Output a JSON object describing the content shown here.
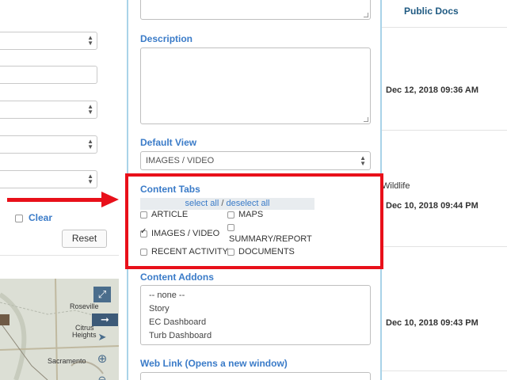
{
  "left_panel": {
    "clear_label": "Clear",
    "reset_label": "Reset"
  },
  "map": {
    "labels": [
      "Roseville",
      "Citrus",
      "Heights",
      "Sacramento"
    ],
    "expand_icon": "expand-icon",
    "arrow_icon": "arrow-right-icon",
    "pointer_icon": "cursor-icon",
    "zoom_icon": "zoom-in-icon"
  },
  "form": {
    "description_label": "Description",
    "default_view_label": "Default View",
    "default_view_value": "IMAGES / VIDEO",
    "content_tabs_label": "Content Tabs",
    "select_all": "select all",
    "separator": "/",
    "deselect_all": "deselect all",
    "tabs": [
      {
        "label": "ARTICLE",
        "checked": false
      },
      {
        "label": "MAPS",
        "checked": false
      },
      {
        "label": "IMAGES / VIDEO",
        "checked": true
      },
      {
        "label": "SUMMARY/REPORT",
        "checked": false
      },
      {
        "label": "RECENT ACTIVITY",
        "checked": false
      },
      {
        "label": "DOCUMENTS",
        "checked": false
      }
    ],
    "content_addons_label": "Content Addons",
    "addons": [
      "-- none --",
      "Story",
      "EC Dashboard",
      "Turb Dashboard"
    ],
    "web_link_label": "Web Link (Opens a new window)"
  },
  "results": {
    "header": "Public Docs",
    "rows": [
      {
        "date": "Dec 12, 2018 09:36 AM"
      },
      {
        "extra": "Wildlife",
        "date": "Dec 10, 2018 09:44 PM"
      },
      {
        "date": "Dec 10, 2018 09:43 PM"
      }
    ]
  },
  "colors": {
    "accent": "#3a7bc8",
    "annotation": "#e8101a",
    "panel_border": "#a9d3e8"
  }
}
